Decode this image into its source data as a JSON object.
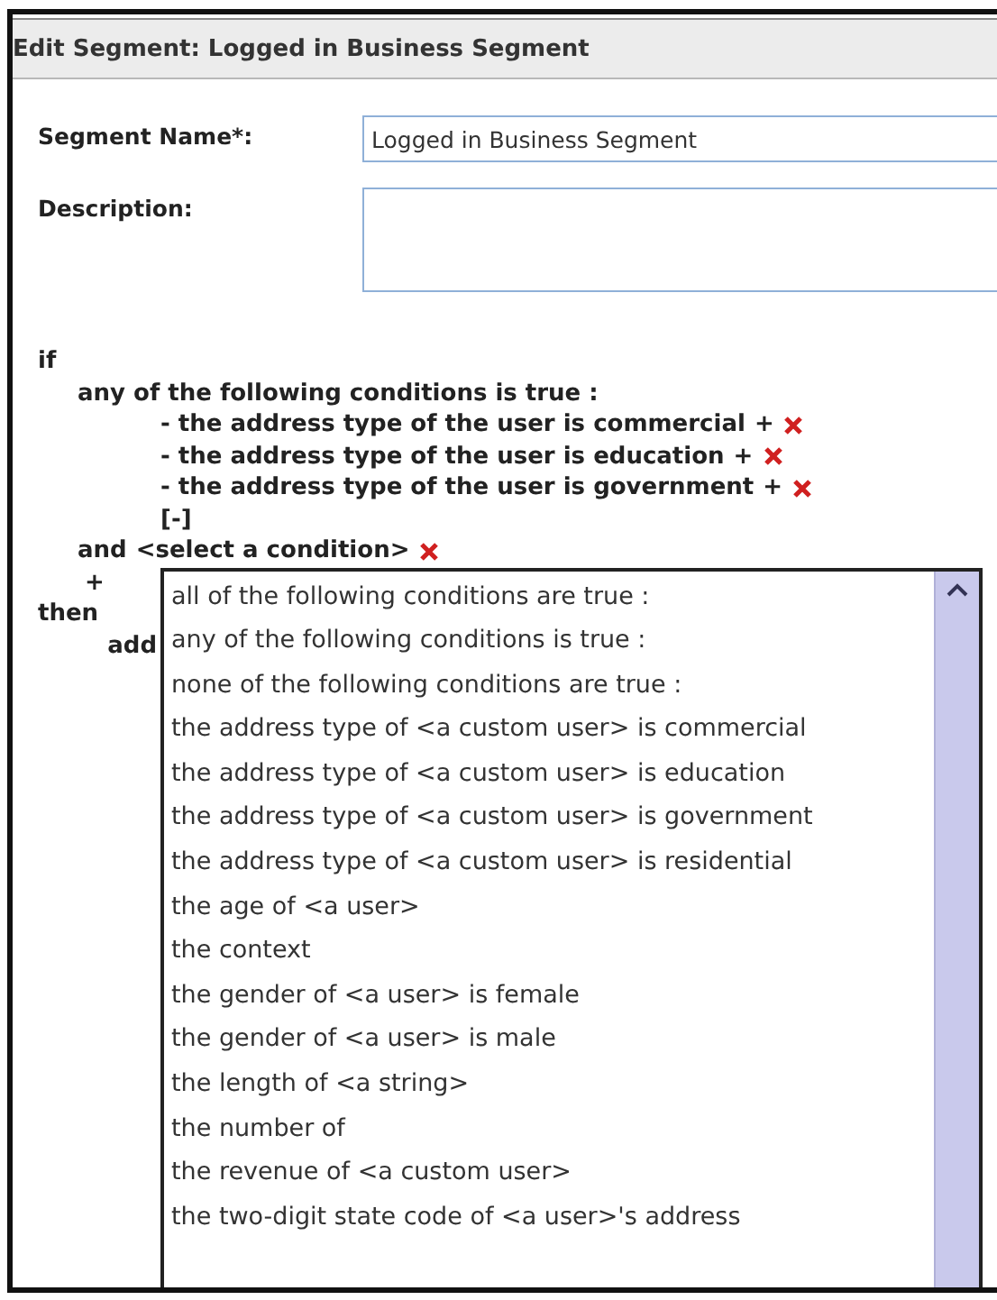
{
  "window": {
    "title": "Edit Segment: Logged in Business Segment"
  },
  "form": {
    "name_label": "Segment Name*:",
    "name_value": "Logged in Business Segment",
    "description_label": "Description:"
  },
  "rule": {
    "if_label": "if",
    "group_label": "any of the following conditions is true :",
    "conditions": [
      {
        "text": "- the address type of the user is commercial",
        "plus": "+"
      },
      {
        "text": "- the address type of the user is education",
        "plus": "+"
      },
      {
        "text": "- the address type of the user is government",
        "plus": "+"
      }
    ],
    "collapse": "[-]",
    "and_label": "and",
    "select_condition": "<select a condition>",
    "add_plus": "+",
    "then_label": "then",
    "add_label": "add"
  },
  "dropdown": {
    "options": [
      "all of the following conditions are true :",
      "any of the following conditions is true :",
      "none of the following conditions are true :",
      "the address type of <a custom user> is commercial",
      "the address type of <a custom user> is education",
      "the address type of <a custom user> is government",
      "the address type of <a custom user> is residential",
      "the age of <a user>",
      "the context",
      "the gender of <a user> is female",
      "the gender of <a user> is male",
      "the length of <a string>",
      "the number of",
      "the revenue of <a custom user>",
      "the two-digit state code of <a user>'s address"
    ]
  }
}
